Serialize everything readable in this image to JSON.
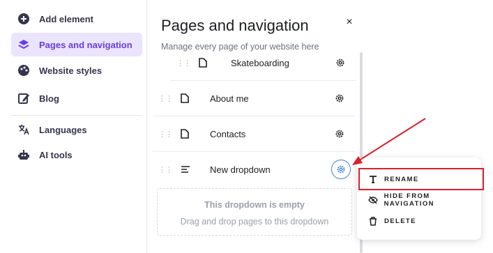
{
  "sidebar": {
    "items": [
      {
        "label": "Add element",
        "icon": "plus-circle-icon"
      },
      {
        "label": "Pages and navigation",
        "icon": "layers-icon"
      },
      {
        "label": "Website styles",
        "icon": "palette-icon"
      },
      {
        "label": "Blog",
        "icon": "edit-icon"
      },
      {
        "label": "Languages",
        "icon": "translate-icon"
      },
      {
        "label": "AI tools",
        "icon": "robot-icon"
      }
    ]
  },
  "panel": {
    "title": "Pages and navigation",
    "subtitle": "Manage every page of your website here",
    "close": "×",
    "pages": [
      {
        "label": "Skateboarding",
        "type": "page"
      },
      {
        "label": "About me",
        "type": "page"
      },
      {
        "label": "Contacts",
        "type": "page"
      },
      {
        "label": "New dropdown",
        "type": "dropdown"
      }
    ],
    "empty_dropdown": {
      "title": "This dropdown is empty",
      "hint": "Drag and drop pages to this dropdown"
    }
  },
  "context_menu": {
    "items": [
      {
        "label": "RENAME",
        "icon": "text-icon"
      },
      {
        "label": "HIDE FROM NAVIGATION",
        "icon": "eye-off-icon"
      },
      {
        "label": "DELETE",
        "icon": "trash-icon"
      }
    ]
  },
  "colors": {
    "accent": "#673de6",
    "active_bg": "#ebe4ff",
    "annotation_red": "#d9202a",
    "gear_highlight": "#3b82d6"
  }
}
